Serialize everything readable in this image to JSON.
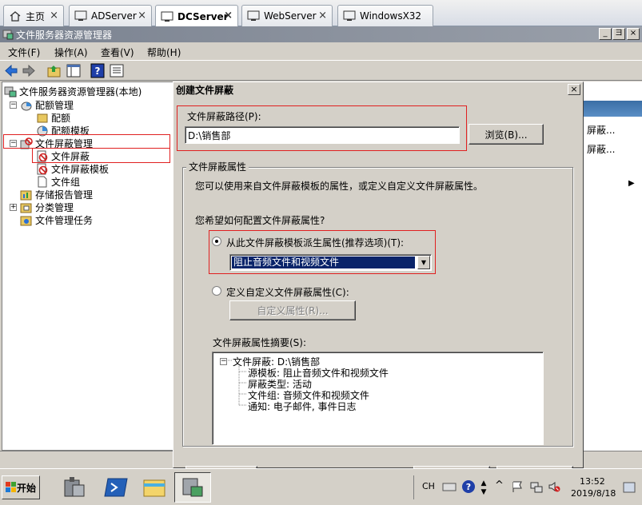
{
  "tabs": [
    {
      "label": "主页",
      "icon": "home-icon"
    },
    {
      "label": "ADServer",
      "icon": "vm-icon"
    },
    {
      "label": "DCServer",
      "icon": "vm-icon"
    },
    {
      "label": "WebServer",
      "icon": "vm-icon"
    },
    {
      "label": "WindowsX32",
      "icon": "vm-icon"
    }
  ],
  "window": {
    "title": "文件服务器资源管理器",
    "minimize": "_",
    "restore": "ヨ",
    "close": "×"
  },
  "menubar": [
    "文件(F)",
    "操作(A)",
    "查看(V)",
    "帮助(H)"
  ],
  "toolbar": [
    "back-icon",
    "forward-icon",
    "up-folder-icon",
    "show-hide-tree-icon",
    "help-icon",
    "properties-icon"
  ],
  "tree": {
    "root": "文件服务器资源管理器(本地)",
    "quota": "配额管理",
    "quota_items": [
      "配额",
      "配额模板"
    ],
    "screening": "文件屏蔽管理",
    "screening_items": [
      "文件屏蔽",
      "文件屏蔽模板",
      "文件组"
    ],
    "reports": "存储报告管理",
    "classification": "分类管理",
    "tasks": "文件管理任务"
  },
  "actions_pane": {
    "items": [
      "屏蔽...",
      "屏蔽..."
    ]
  },
  "dialog": {
    "title": "创建文件屏蔽",
    "close": "×",
    "path_label": "文件屏蔽路径(P):",
    "path_value": "D:\\销售部",
    "browse_button": "浏览(B)...",
    "props_group": "文件屏蔽属性",
    "props_desc": "您可以使用来自文件屏蔽模板的属性，或定义自定义文件屏蔽属性。",
    "question": "您希望如何配置文件屏蔽属性?",
    "option_template": "从此文件屏蔽模板派生属性(推荐选项)(T):",
    "template_selected": "阻止音频文件和视频文件",
    "option_custom": "定义自定义文件屏蔽属性(C):",
    "custom_button": "自定义属性(R)...",
    "summary_label": "文件屏蔽属性摘要(S):",
    "summary": {
      "root": "文件屏蔽: D:\\销售部",
      "lines": [
        "源模板: 阻止音频文件和视频文件",
        "屏蔽类型: 活动",
        "文件组: 音频文件和视频文件",
        "通知: 电子邮件, 事件日志"
      ]
    }
  },
  "taskbar": {
    "start": "开始",
    "apps": [
      "server-manager-icon",
      "powershell-icon",
      "explorer-icon",
      "fsrm-icon"
    ],
    "lang": "CH",
    "time": "13:52",
    "date": "2019/8/18"
  }
}
